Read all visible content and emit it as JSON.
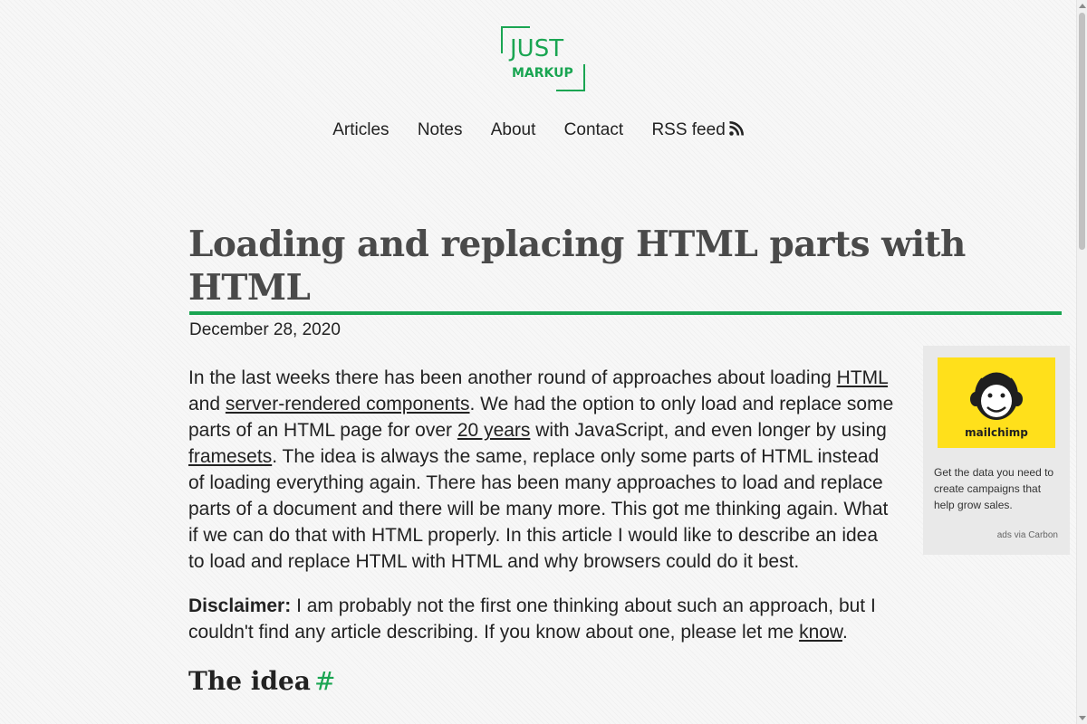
{
  "logo": {
    "line1": "JUST",
    "line2": "MARKUP"
  },
  "nav": {
    "items": [
      {
        "label": "Articles"
      },
      {
        "label": "Notes"
      },
      {
        "label": "About"
      },
      {
        "label": "Contact"
      },
      {
        "label": "RSS feed"
      }
    ]
  },
  "article": {
    "title": "Loading and replacing HTML parts with HTML",
    "date": "December 28, 2020",
    "p1": {
      "t1": "In the last weeks there has been another round of approaches about loading ",
      "link1": "HTML",
      "t2": " and ",
      "link2": "server-rendered components",
      "t3": ". We had the option to only load and replace some parts of an HTML page for over ",
      "link3": "20 years",
      "t4": " with JavaScript, and even longer by using ",
      "link4": "framesets",
      "t5": ". The idea is always the same, replace only some parts of HTML instead of loading everything again. There has been many approaches to load and replace parts of a document and there will be many more. This got me thinking again. What if we can do that with HTML properly. In this article I would like to describe an idea to load and replace HTML with HTML and why browsers could do it best."
    },
    "p2": {
      "label": "Disclaimer:",
      "t1": " I am probably not the first one thinking about such an approach, but I couldn't find any article describing. If you know about one, please let me ",
      "link": "know",
      "t2": "."
    },
    "section_heading": "The idea",
    "section_anchor": "#"
  },
  "ad": {
    "brand": "mailchimp",
    "text": "Get the data you need to create campaigns that help grow sales.",
    "via": "ads via Carbon",
    "image_bg": "#ffe01b"
  },
  "colors": {
    "accent": "#1aa552",
    "title": "#4a4a4a",
    "text": "#222222"
  }
}
